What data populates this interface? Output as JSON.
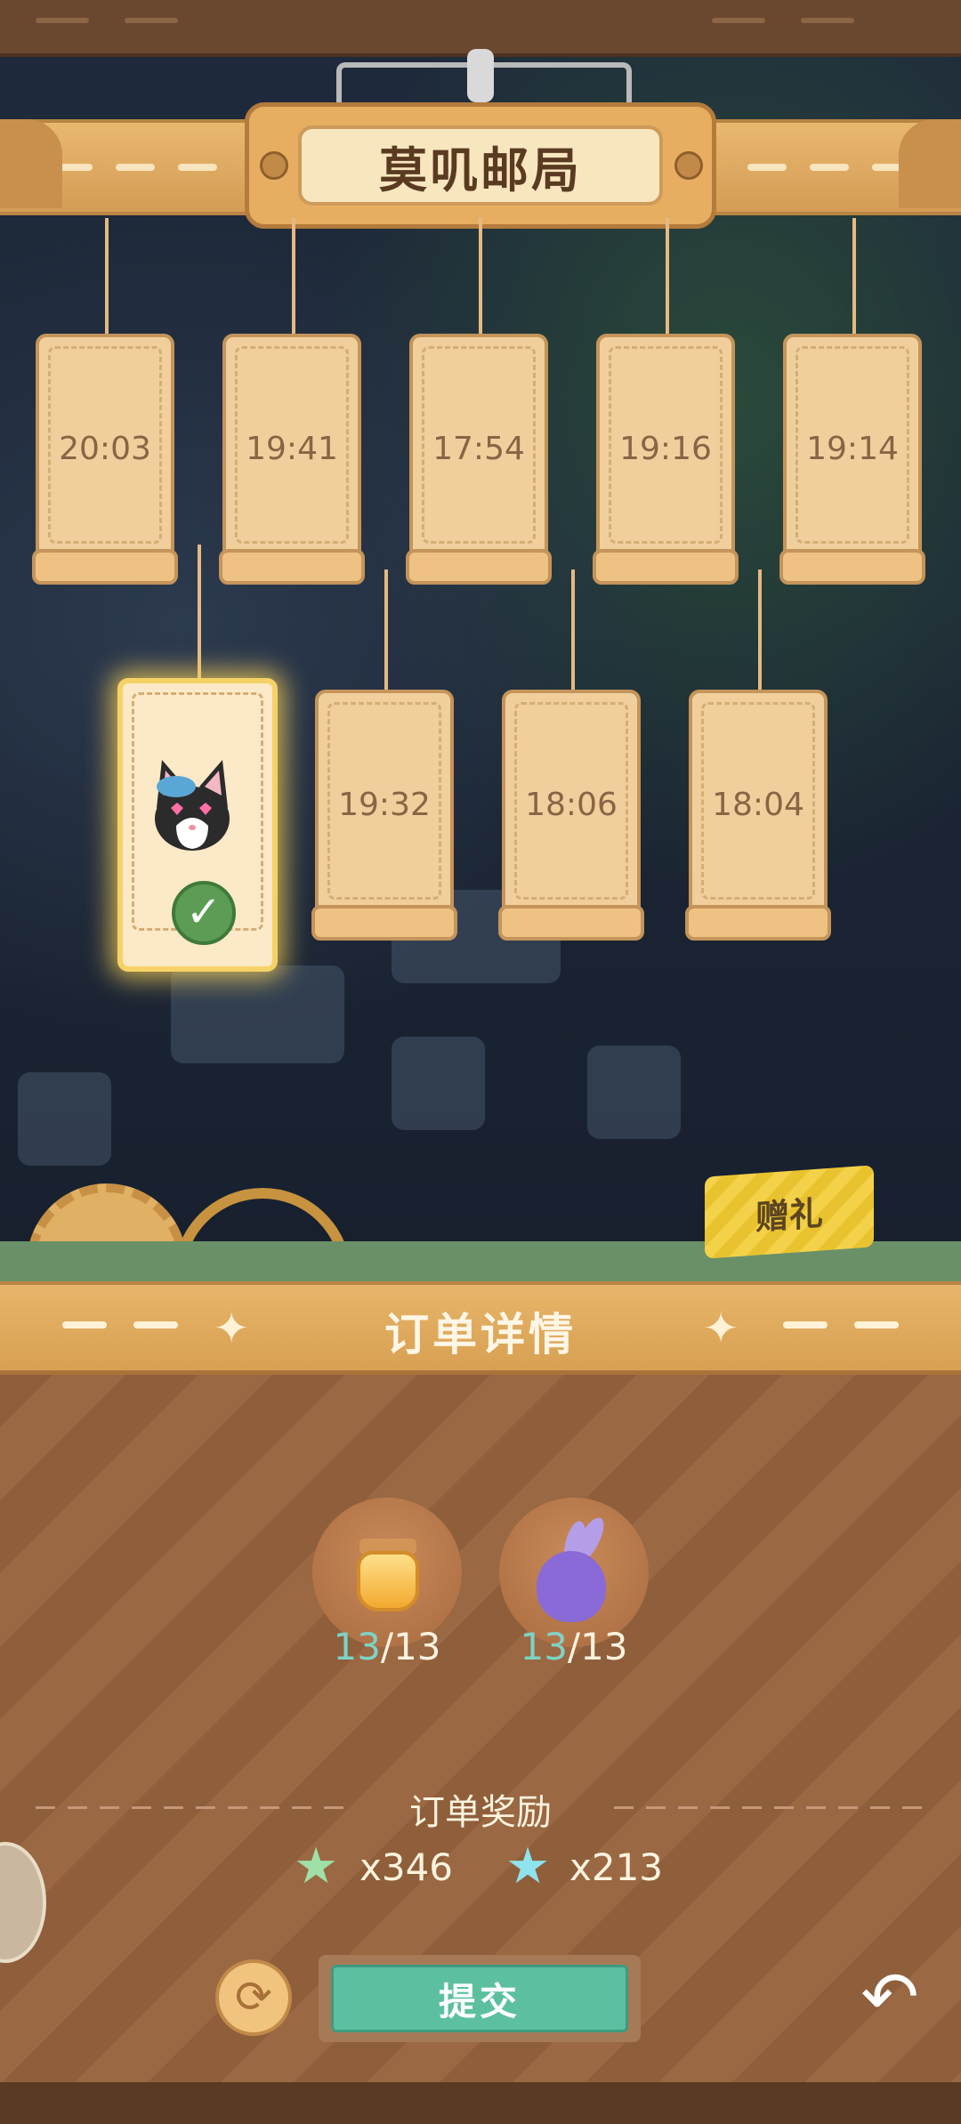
{
  "post_office": {
    "title": "莫叽邮局"
  },
  "letters_row1": [
    {
      "time": "20:03"
    },
    {
      "time": "19:41"
    },
    {
      "time": "17:54"
    },
    {
      "time": "19:16"
    },
    {
      "time": "19:14"
    }
  ],
  "letters_row2": [
    {
      "time": "19:32"
    },
    {
      "time": "18:06"
    },
    {
      "time": "18:04"
    }
  ],
  "selected_letter": {
    "icon": "cat-portrait-icon",
    "status_icon": "check-icon"
  },
  "gift_button": {
    "label": "赠礼"
  },
  "order": {
    "title": "订单详情",
    "items": [
      {
        "icon": "honey-jar-icon",
        "have": "13",
        "need": "/13"
      },
      {
        "icon": "purple-turnip-icon",
        "have": "13",
        "need": "/13"
      }
    ],
    "reward_title": "订单奖励",
    "rewards": [
      {
        "icon": "rainbow-star-icon",
        "value": "x346"
      },
      {
        "icon": "cyan-star-icon",
        "value": "x213"
      }
    ],
    "submit_label": "提交"
  },
  "colors": {
    "wood": "#9a6842",
    "board": "#e7ae62",
    "submit": "#5cc0a0",
    "count_have": "#7fd2c6",
    "selected_glow": "#f6d266"
  }
}
